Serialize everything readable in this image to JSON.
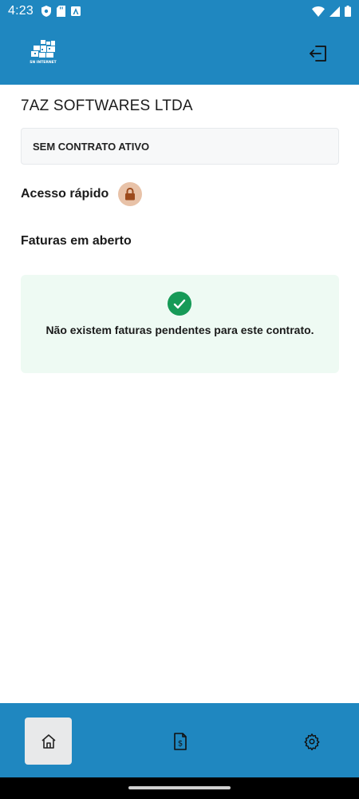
{
  "status_bar": {
    "time": "4:23"
  },
  "header": {
    "logo_text": "SN INTERNET",
    "logout_icon": "logout-icon"
  },
  "company": {
    "name": "7AZ SOFTWARES LTDA"
  },
  "contract": {
    "status": "SEM CONTRATO ATIVO"
  },
  "quick_access": {
    "title": "Acesso rápido",
    "icon": "lock-icon"
  },
  "invoices": {
    "title": "Faturas em aberto",
    "empty_message": "Não existem faturas pendentes para este contrato."
  },
  "bottom_nav": {
    "items": [
      {
        "name": "home",
        "icon": "home-icon",
        "active": true
      },
      {
        "name": "invoices",
        "icon": "invoice-icon",
        "active": false
      },
      {
        "name": "settings",
        "icon": "gear-icon",
        "active": false
      }
    ]
  },
  "colors": {
    "brand": "#1f87c0",
    "success": "#169a57",
    "success_bg": "#eefaf3",
    "lock_bg": "#e8c2a8",
    "lock": "#9c4a1c"
  }
}
